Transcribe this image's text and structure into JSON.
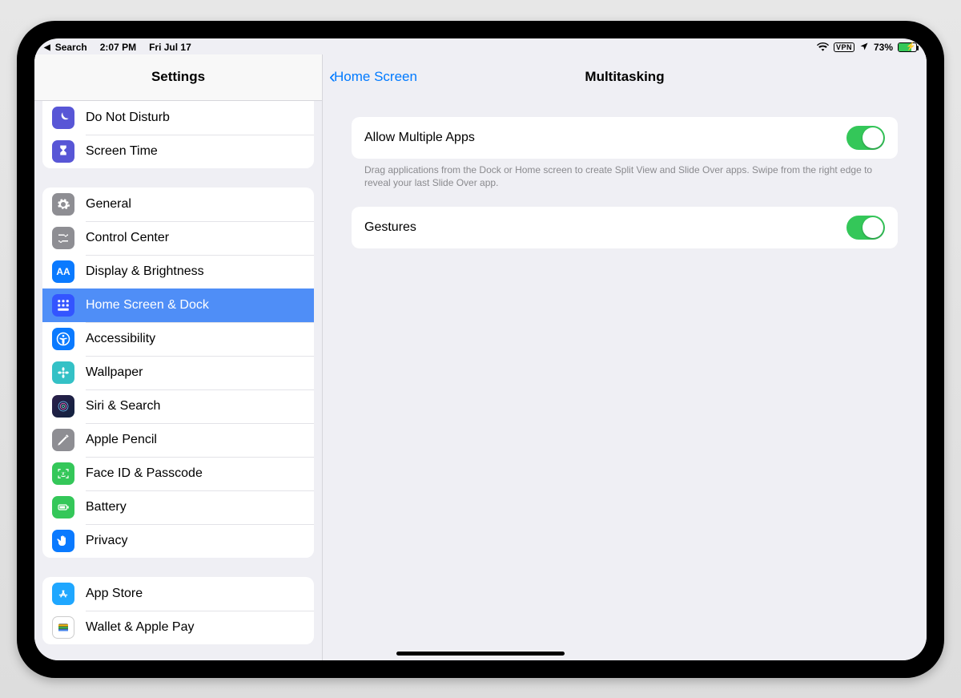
{
  "statusbar": {
    "back_app": "Search",
    "time": "2:07 PM",
    "date": "Fri Jul 17",
    "vpn_label": "VPN",
    "battery_pct": "73%",
    "battery_fill_pct": 73
  },
  "sidebar": {
    "title": "Settings",
    "group_top": [
      {
        "id": "dnd",
        "label": "Do Not Disturb",
        "icon_bg": "#5856d6",
        "icon": "moon"
      },
      {
        "id": "screen-time",
        "label": "Screen Time",
        "icon_bg": "#5856d6",
        "icon": "hourglass"
      }
    ],
    "group_main": [
      {
        "id": "general",
        "label": "General",
        "icon_bg": "#8e8e93",
        "icon": "gear"
      },
      {
        "id": "control-center",
        "label": "Control Center",
        "icon_bg": "#8e8e93",
        "icon": "sliders"
      },
      {
        "id": "display",
        "label": "Display & Brightness",
        "icon_bg": "#0a7aff",
        "icon": "aa"
      },
      {
        "id": "home-dock",
        "label": "Home Screen & Dock",
        "icon_bg": "#3355ff",
        "icon": "grid",
        "active": true
      },
      {
        "id": "accessibility",
        "label": "Accessibility",
        "icon_bg": "#0a7aff",
        "icon": "person"
      },
      {
        "id": "wallpaper",
        "label": "Wallpaper",
        "icon_bg": "#34c1c6",
        "icon": "flower"
      },
      {
        "id": "siri",
        "label": "Siri & Search",
        "icon_bg": "#1b1b2f",
        "icon": "siri"
      },
      {
        "id": "pencil",
        "label": "Apple Pencil",
        "icon_bg": "#8e8e93",
        "icon": "pencil"
      },
      {
        "id": "faceid",
        "label": "Face ID & Passcode",
        "icon_bg": "#34c759",
        "icon": "face"
      },
      {
        "id": "battery",
        "label": "Battery",
        "icon_bg": "#34c759",
        "icon": "battery"
      },
      {
        "id": "privacy",
        "label": "Privacy",
        "icon_bg": "#0a7aff",
        "icon": "hand"
      }
    ],
    "group_store": [
      {
        "id": "appstore",
        "label": "App Store",
        "icon_bg": "#1fa7ff",
        "icon": "appstore"
      },
      {
        "id": "wallet",
        "label": "Wallet & Apple Pay",
        "icon_bg": "#ffffff",
        "icon": "wallet",
        "icon_border": true
      }
    ]
  },
  "detail": {
    "back_label": "Home Screen",
    "title": "Multitasking",
    "rows": {
      "allow_multiple_label": "Allow Multiple Apps",
      "allow_multiple_on": true,
      "allow_multiple_desc": "Drag applications from the Dock or Home screen to create Split View and Slide Over apps. Swipe from the right edge to reveal your last Slide Over app.",
      "gestures_label": "Gestures",
      "gestures_on": true
    }
  }
}
